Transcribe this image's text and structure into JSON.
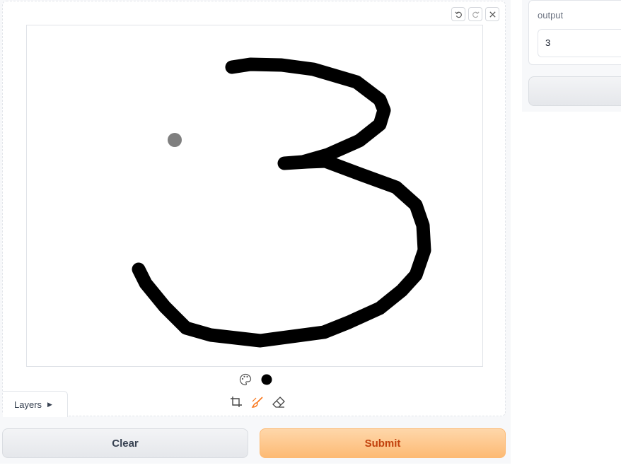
{
  "editor": {
    "undo_icon": "undo-icon",
    "redo_icon": "redo-icon",
    "close_icon": "close-icon",
    "palette_icon": "palette-icon",
    "selected_color": "#000000",
    "crop_icon": "crop-icon",
    "brush_icon": "brush-icon",
    "eraser_icon": "eraser-icon",
    "brush_active_color": "#f97316",
    "layers_label": "Layers",
    "drawn_digit_description_color": "#000000"
  },
  "actions": {
    "clear_label": "Clear",
    "submit_label": "Submit"
  },
  "output": {
    "label": "output",
    "value": "3"
  }
}
